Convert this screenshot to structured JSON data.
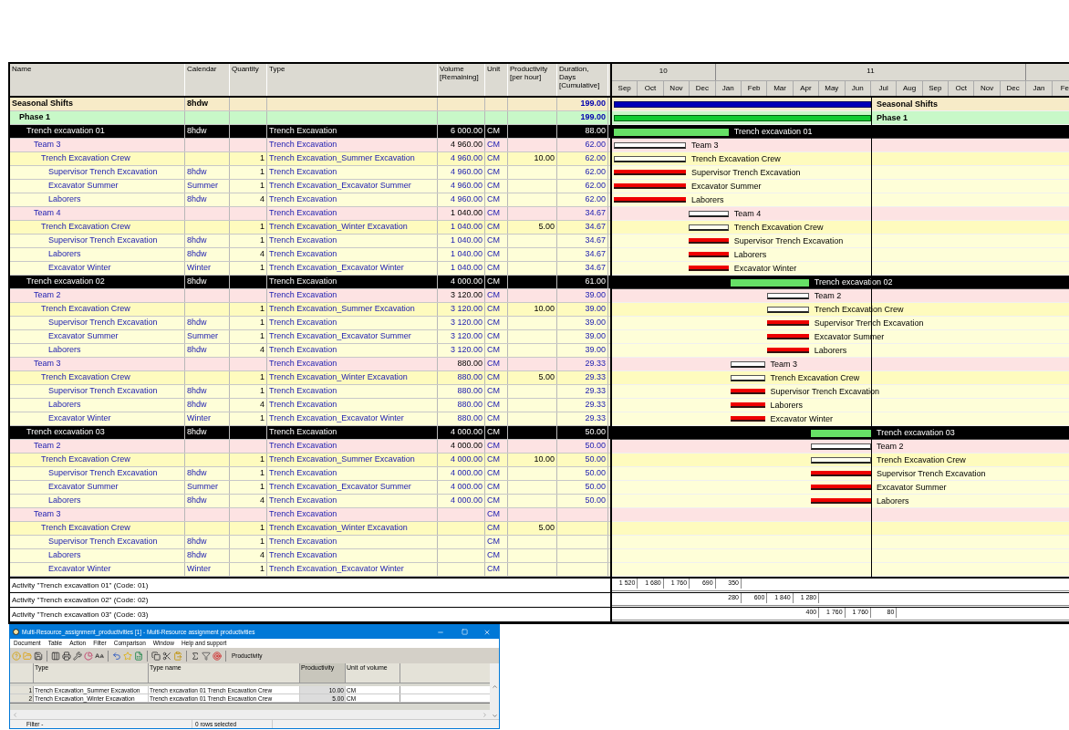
{
  "table": {
    "columns": [
      "Name",
      "Calendar",
      "Quantity",
      "Type",
      "Volume\n[Remaining]",
      "Unit",
      "Productivity\n[per hour]",
      "Duration, Days\n[Cumulative]"
    ]
  },
  "gantt": {
    "years": [
      "10",
      "11"
    ],
    "months": [
      "Sep",
      "Oct",
      "Nov",
      "Dec",
      "Jan",
      "Feb",
      "Mar",
      "Apr",
      "May",
      "Jun",
      "Jul",
      "Aug",
      "Sep",
      "Oct",
      "Nov",
      "Dec",
      "Jan",
      "Fe"
    ]
  },
  "tree": [
    {
      "kind": "project",
      "name": "Seasonal Shifts",
      "calendar": "8hdw",
      "duration": "199.00",
      "bar_label": "Seasonal Shifts",
      "children": [
        {
          "kind": "phase",
          "name": "Phase 1",
          "duration": "199.00",
          "bar_label": "Phase 1",
          "children": [
            {
              "kind": "activity",
              "name": "Trench excavation 01",
              "calendar": "8hdw",
              "type": "Trench Excavation",
              "volume": "6 000.00",
              "unit": "CM",
              "duration": "88.00",
              "bar_label": "Trench excavation 01",
              "children": [
                {
                  "kind": "team",
                  "name": "Team 3",
                  "type": "Trench Excavation",
                  "volume": "4 960.00",
                  "unit": "CM",
                  "duration": "62.00",
                  "bar_label": "Team 3",
                  "children": [
                    {
                      "kind": "crew",
                      "name": "Trench Excavation Crew",
                      "quantity": "1",
                      "type": "Trench Excavation_Summer Excavation",
                      "volume": "4 960.00",
                      "unit": "CM",
                      "productivity": "10.00",
                      "duration": "62.00",
                      "bar_label": "Trench Excavation Crew",
                      "children": [
                        {
                          "kind": "resource",
                          "name": "Supervisor Trench Excavation",
                          "calendar": "8hdw",
                          "quantity": "1",
                          "type": "Trench Excavation",
                          "volume": "4 960.00",
                          "unit": "CM",
                          "duration": "62.00",
                          "bar_label": "Supervisor Trench Excavation"
                        },
                        {
                          "kind": "resource",
                          "name": "Excavator Summer",
                          "calendar": "Summer",
                          "quantity": "1",
                          "type": "Trench Excavation_Excavator Summer",
                          "volume": "4 960.00",
                          "unit": "CM",
                          "duration": "62.00",
                          "bar_label": "Excavator Summer"
                        },
                        {
                          "kind": "resource",
                          "name": "Laborers",
                          "calendar": "8hdw",
                          "quantity": "4",
                          "type": "Trench Excavation",
                          "volume": "4 960.00",
                          "unit": "CM",
                          "duration": "62.00",
                          "bar_label": "Laborers"
                        }
                      ]
                    }
                  ]
                },
                {
                  "kind": "team",
                  "name": "Team 4",
                  "type": "Trench Excavation",
                  "volume": "1 040.00",
                  "unit": "CM",
                  "duration": "34.67",
                  "bar_label": "Team 4",
                  "children": [
                    {
                      "kind": "crew",
                      "name": "Trench Excavation Crew",
                      "quantity": "1",
                      "type": "Trench Excavation_Winter Excavation",
                      "volume": "1 040.00",
                      "unit": "CM",
                      "productivity": "5.00",
                      "duration": "34.67",
                      "bar_label": "Trench Excavation Crew",
                      "children": [
                        {
                          "kind": "resource",
                          "name": "Supervisor Trench Excavation",
                          "calendar": "8hdw",
                          "quantity": "1",
                          "type": "Trench Excavation",
                          "volume": "1 040.00",
                          "unit": "CM",
                          "duration": "34.67",
                          "bar_label": "Supervisor Trench Excavation"
                        },
                        {
                          "kind": "resource",
                          "name": "Laborers",
                          "calendar": "8hdw",
                          "quantity": "4",
                          "type": "Trench Excavation",
                          "volume": "1 040.00",
                          "unit": "CM",
                          "duration": "34.67",
                          "bar_label": "Laborers"
                        },
                        {
                          "kind": "resource",
                          "name": "Excavator Winter",
                          "calendar": "Winter",
                          "quantity": "1",
                          "type": "Trench Excavation_Excavator Winter",
                          "volume": "1 040.00",
                          "unit": "CM",
                          "duration": "34.67",
                          "bar_label": "Excavator Winter"
                        }
                      ]
                    }
                  ]
                }
              ]
            },
            {
              "kind": "activity",
              "name": "Trench excavation 02",
              "calendar": "8hdw",
              "type": "Trench Excavation",
              "volume": "4 000.00",
              "unit": "CM",
              "duration": "61.00",
              "bar_label": "Trench excavation 02",
              "children": [
                {
                  "kind": "team",
                  "name": "Team 2",
                  "type": "Trench Excavation",
                  "volume": "3 120.00",
                  "unit": "CM",
                  "duration": "39.00",
                  "bar_label": "Team 2",
                  "children": [
                    {
                      "kind": "crew",
                      "name": "Trench Excavation Crew",
                      "quantity": "1",
                      "type": "Trench Excavation_Summer Excavation",
                      "volume": "3 120.00",
                      "unit": "CM",
                      "productivity": "10.00",
                      "duration": "39.00",
                      "bar_label": "Trench Excavation Crew",
                      "children": [
                        {
                          "kind": "resource",
                          "name": "Supervisor Trench Excavation",
                          "calendar": "8hdw",
                          "quantity": "1",
                          "type": "Trench Excavation",
                          "volume": "3 120.00",
                          "unit": "CM",
                          "duration": "39.00",
                          "bar_label": "Supervisor Trench Excavation"
                        },
                        {
                          "kind": "resource",
                          "name": "Excavator Summer",
                          "calendar": "Summer",
                          "quantity": "1",
                          "type": "Trench Excavation_Excavator Summer",
                          "volume": "3 120.00",
                          "unit": "CM",
                          "duration": "39.00",
                          "bar_label": "Excavator Summer"
                        },
                        {
                          "kind": "resource",
                          "name": "Laborers",
                          "calendar": "8hdw",
                          "quantity": "4",
                          "type": "Trench Excavation",
                          "volume": "3 120.00",
                          "unit": "CM",
                          "duration": "39.00",
                          "bar_label": "Laborers"
                        }
                      ]
                    }
                  ]
                },
                {
                  "kind": "team",
                  "name": "Team 3",
                  "type": "Trench Excavation",
                  "volume": "880.00",
                  "unit": "CM",
                  "duration": "29.33",
                  "bar_label": "Team 3",
                  "children": [
                    {
                      "kind": "crew",
                      "name": "Trench Excavation Crew",
                      "quantity": "1",
                      "type": "Trench Excavation_Winter Excavation",
                      "volume": "880.00",
                      "unit": "CM",
                      "productivity": "5.00",
                      "duration": "29.33",
                      "bar_label": "Trench Excavation Crew",
                      "children": [
                        {
                          "kind": "resource",
                          "name": "Supervisor Trench Excavation",
                          "calendar": "8hdw",
                          "quantity": "1",
                          "type": "Trench Excavation",
                          "volume": "880.00",
                          "unit": "CM",
                          "duration": "29.33",
                          "bar_label": "Supervisor Trench Excavation"
                        },
                        {
                          "kind": "resource",
                          "name": "Laborers",
                          "calendar": "8hdw",
                          "quantity": "4",
                          "type": "Trench Excavation",
                          "volume": "880.00",
                          "unit": "CM",
                          "duration": "29.33",
                          "bar_label": "Laborers"
                        },
                        {
                          "kind": "resource",
                          "name": "Excavator Winter",
                          "calendar": "Winter",
                          "quantity": "1",
                          "type": "Trench Excavation_Excavator Winter",
                          "volume": "880.00",
                          "unit": "CM",
                          "duration": "29.33",
                          "bar_label": "Excavator Winter"
                        }
                      ]
                    }
                  ]
                }
              ]
            },
            {
              "kind": "activity",
              "name": "Trench excavation 03",
              "calendar": "8hdw",
              "type": "Trench Excavation",
              "volume": "4 000.00",
              "unit": "CM",
              "duration": "50.00",
              "bar_label": "Trench excavation 03",
              "children": [
                {
                  "kind": "team",
                  "name": "Team 2",
                  "type": "Trench Excavation",
                  "volume": "4 000.00",
                  "unit": "CM",
                  "duration": "50.00",
                  "bar_label": "Team 2",
                  "children": [
                    {
                      "kind": "crew",
                      "name": "Trench Excavation Crew",
                      "quantity": "1",
                      "type": "Trench Excavation_Summer Excavation",
                      "volume": "4 000.00",
                      "unit": "CM",
                      "productivity": "10.00",
                      "duration": "50.00",
                      "bar_label": "Trench Excavation Crew",
                      "children": [
                        {
                          "kind": "resource",
                          "name": "Supervisor Trench Excavation",
                          "calendar": "8hdw",
                          "quantity": "1",
                          "type": "Trench Excavation",
                          "volume": "4 000.00",
                          "unit": "CM",
                          "duration": "50.00",
                          "bar_label": "Supervisor Trench Excavation"
                        },
                        {
                          "kind": "resource",
                          "name": "Excavator Summer",
                          "calendar": "Summer",
                          "quantity": "1",
                          "type": "Trench Excavation_Excavator Summer",
                          "volume": "4 000.00",
                          "unit": "CM",
                          "duration": "50.00",
                          "bar_label": "Excavator Summer"
                        },
                        {
                          "kind": "resource",
                          "name": "Laborers",
                          "calendar": "8hdw",
                          "quantity": "4",
                          "type": "Trench Excavation",
                          "volume": "4 000.00",
                          "unit": "CM",
                          "duration": "50.00",
                          "bar_label": "Laborers"
                        }
                      ]
                    }
                  ]
                },
                {
                  "kind": "team",
                  "name": "Team 3",
                  "type": "Trench Excavation",
                  "unit": "CM",
                  "children": [
                    {
                      "kind": "crew",
                      "name": "Trench Excavation Crew",
                      "quantity": "1",
                      "type": "Trench Excavation_Winter Excavation",
                      "unit": "CM",
                      "productivity": "5.00",
                      "children": [
                        {
                          "kind": "resource",
                          "name": "Supervisor Trench Excavation",
                          "calendar": "8hdw",
                          "quantity": "1",
                          "type": "Trench Excavation",
                          "unit": "CM"
                        },
                        {
                          "kind": "resource",
                          "name": "Laborers",
                          "calendar": "8hdw",
                          "quantity": "4",
                          "type": "Trench Excavation",
                          "unit": "CM"
                        },
                        {
                          "kind": "resource",
                          "name": "Excavator Winter",
                          "calendar": "Winter",
                          "quantity": "1",
                          "type": "Trench Excavation_Excavator Winter",
                          "unit": "CM"
                        }
                      ]
                    }
                  ]
                }
              ]
            }
          ]
        }
      ]
    }
  ],
  "histogram_rows": [
    {
      "label": "Activity \"Trench excavation 01\" (Code: 01)",
      "values": [
        "1 520",
        "1 680",
        "1 760",
        "690",
        "350"
      ]
    },
    {
      "label": "Activity \"Trench excavation 02\" (Code: 02)",
      "values": [
        "280",
        "600",
        "1 840",
        "1 280"
      ]
    },
    {
      "label": "Activity \"Trench excavation 03\" (Code: 03)",
      "values": [
        "400",
        "1 760",
        "1 760",
        "80"
      ]
    }
  ],
  "window": {
    "title": "Multi-Resource_assignment_productivities [1] - Multi-Resource assignment productivities",
    "menu": [
      "Document",
      "Table",
      "Action",
      "Filter",
      "Comparison",
      "Window",
      "Help and support"
    ],
    "toolbar_label": "Productivity",
    "columns": [
      "Type",
      "Type name",
      "Productivity",
      "Unit of volume"
    ],
    "rows": [
      {
        "index": "1",
        "type": "Trench Excavation_Summer Excavation",
        "type_name": "Trench excavation 01 Trench Excavation Crew",
        "productivity": "10.00",
        "unit": "CM"
      },
      {
        "index": "2",
        "type": "Trench Excavation_Winter Excavation",
        "type_name": "Trench excavation 01 Trench Excavation Crew",
        "productivity": "5.00",
        "unit": "CM"
      }
    ],
    "status": [
      "Filter -",
      "0 rows selected"
    ]
  }
}
